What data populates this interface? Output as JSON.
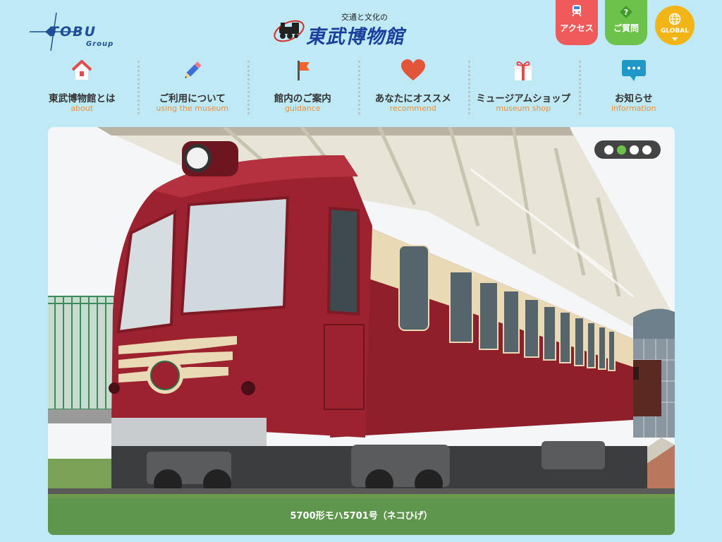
{
  "header": {
    "tobu_logo": {
      "text": "TOBU",
      "sub": "Group"
    },
    "museum_logo": {
      "subtitle": "交通と文化の",
      "title": "東武博物館"
    },
    "buttons": {
      "access": "アクセス",
      "faq": "ご質問",
      "global": "GLOBAL"
    }
  },
  "nav": {
    "items": [
      {
        "jp": "東武博物館とは",
        "en": "about",
        "icon": "house-icon"
      },
      {
        "jp": "ご利用について",
        "en": "using the museum",
        "icon": "pencil-icon"
      },
      {
        "jp": "館内のご案内",
        "en": "guidance",
        "icon": "flag-icon"
      },
      {
        "jp": "あなたにオススメ",
        "en": "recommend",
        "icon": "heart-icon"
      },
      {
        "jp": "ミュージアムショップ",
        "en": "museum shop",
        "icon": "gift-icon"
      },
      {
        "jp": "お知らせ",
        "en": "information",
        "icon": "speech-bubble-icon"
      }
    ]
  },
  "hero": {
    "caption": "5700形モハ5701号（ネコひげ）",
    "slides_total": 4,
    "active_slide": 2
  },
  "colors": {
    "background": "#bfe9f5",
    "accent_orange": "#e98f3c",
    "access_red": "#f05a5a",
    "faq_green": "#6cc24a",
    "global_yellow": "#f3b416",
    "train_maroon": "#8e1f2b",
    "train_cream": "#e9d9b4"
  }
}
